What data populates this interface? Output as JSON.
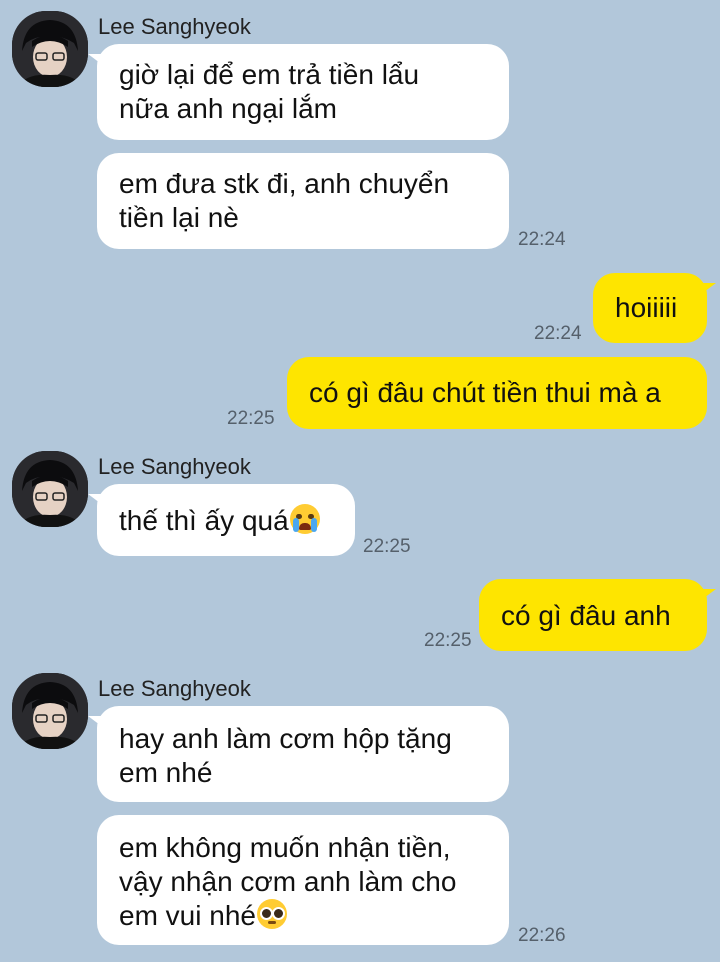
{
  "contact": {
    "name": "Lee Sanghyeok"
  },
  "colors": {
    "background": "#b2c7da",
    "incoming_bubble": "#ffffff",
    "outgoing_bubble": "#fee500",
    "timestamp": "#55606b"
  },
  "messages": [
    {
      "from": "contact",
      "lines": [
        "giờ lại để em trả tiền lẩu",
        "nữa anh ngại lắm"
      ]
    },
    {
      "from": "contact",
      "lines": [
        "em đưa stk đi, anh chuyển",
        "tiền lại nè"
      ],
      "time": "22:24"
    },
    {
      "from": "me",
      "text": "hoiiiii",
      "time": "22:24"
    },
    {
      "from": "me",
      "text": "có gì đâu chút tiền thui mà a",
      "time": "22:25"
    },
    {
      "from": "contact",
      "text": "thế thì ấy quá",
      "emoji": "loudly-crying-face",
      "time": "22:25"
    },
    {
      "from": "me",
      "text": "có gì đâu anh",
      "time": "22:25"
    },
    {
      "from": "contact",
      "lines": [
        "hay anh làm cơm hộp tặng",
        "em nhé"
      ]
    },
    {
      "from": "contact",
      "lines": [
        "em không muốn nhận tiền,",
        "vậy nhận cơm anh làm cho",
        "em vui nhé"
      ],
      "emoji": "pleading-face",
      "time": "22:26"
    }
  ]
}
